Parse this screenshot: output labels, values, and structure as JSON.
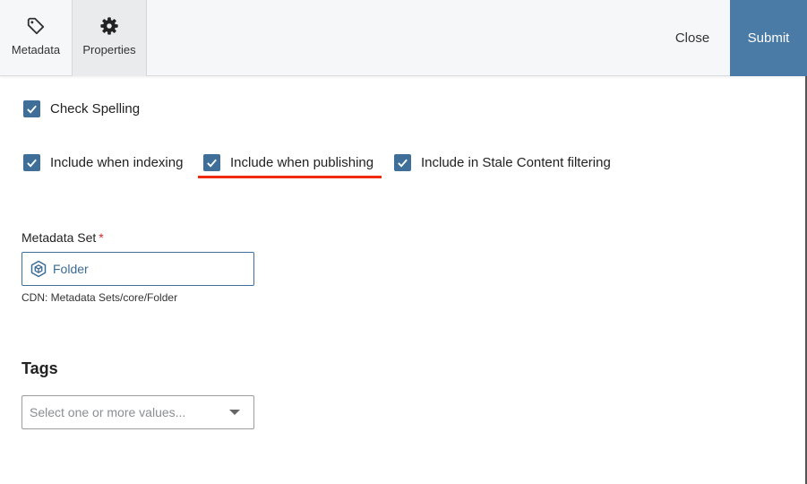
{
  "tabs": [
    {
      "label": "Metadata",
      "icon": "tag-icon"
    },
    {
      "label": "Properties",
      "icon": "gear-icon"
    }
  ],
  "actions": {
    "close_label": "Close",
    "submit_label": "Submit"
  },
  "checkboxes": {
    "check_spelling": {
      "label": "Check Spelling",
      "checked": true
    },
    "include_indexing": {
      "label": "Include when indexing",
      "checked": true
    },
    "include_publishing": {
      "label": "Include when publishing",
      "checked": true
    },
    "include_stale": {
      "label": "Include in Stale Content filtering",
      "checked": true
    }
  },
  "metadata_set": {
    "label": "Metadata Set",
    "required_marker": "*",
    "value": "Folder",
    "icon": "cube-icon",
    "path": "CDN: Metadata Sets/core/Folder"
  },
  "tags": {
    "title": "Tags",
    "placeholder": "Select one or more values..."
  },
  "colors": {
    "accent": "#4a7aa6",
    "checkbox": "#3f6f99",
    "highlight_underline": "#f02a0e",
    "required": "#d9262d"
  }
}
